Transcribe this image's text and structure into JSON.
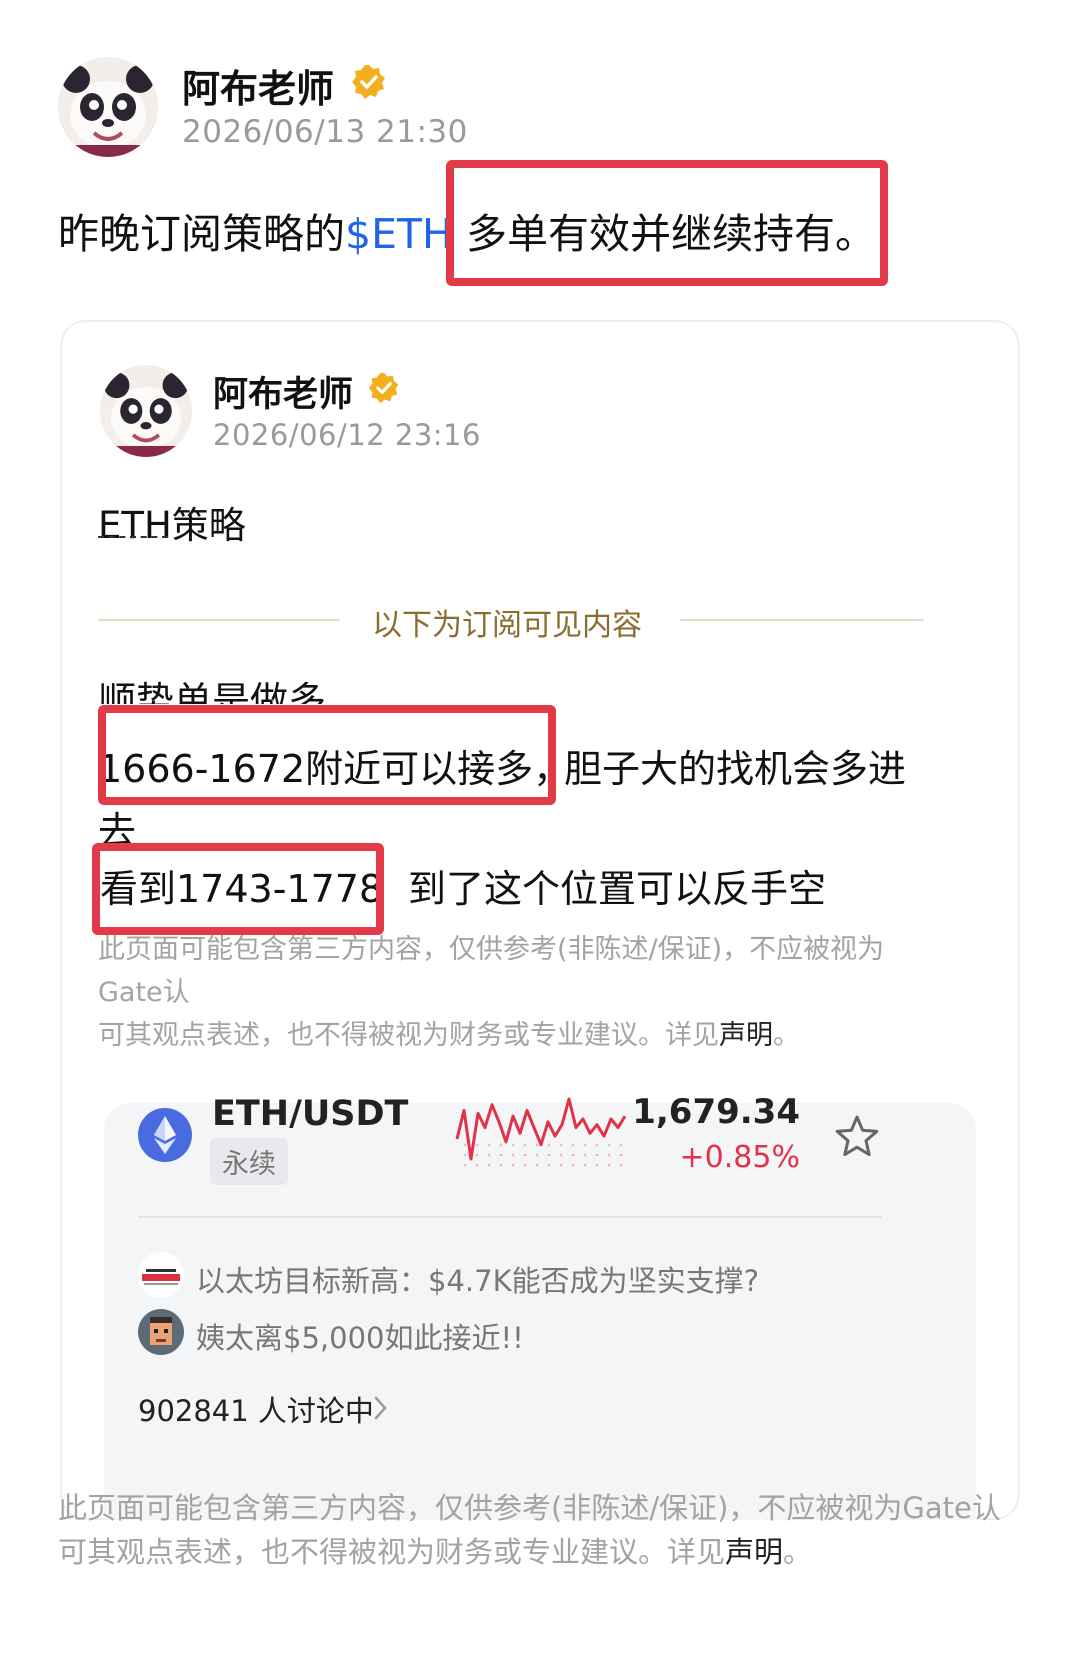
{
  "post": {
    "author": "阿布老师",
    "datetime": "2026/06/13 21:30",
    "text_before": "昨晚订阅策略的",
    "ticker": "$ETH",
    "text_highlight": "多单有效并继续持有。"
  },
  "quoted": {
    "author": "阿布老师",
    "datetime": "2026/06/12 23:16",
    "title": "ETH策略",
    "divider_label": "以下为订阅可见内容",
    "line1": "顺势单是做多",
    "line2_highlight": "1666-1672附近可以接多，",
    "line2_rest": "胆子大的找机会多进",
    "line3": "去",
    "line4_highlight": "看到1743-1778",
    "line4_rest": "到了这个位置可以反手空",
    "disclaimer_1": "此页面可能包含第三方内容，仅供参考(非陈述/保证)，不应被视为Gate认",
    "disclaimer_2": "可其观点表述，也不得被视为财务或专业建议。详见",
    "disclaimer_link": "声明",
    "disclaimer_end": "。"
  },
  "market": {
    "pair": "ETH/USDT",
    "type_tag": "永续",
    "price": "1,679.34",
    "change": "+0.85%",
    "news": [
      {
        "text": "以太坊目标新高：$4.7K能否成为坚实支撑?",
        "icon": "crypto-news-logo-icon"
      },
      {
        "text": "姨太离$5,000如此接近!!",
        "icon": "user-avatar-icon"
      }
    ],
    "discussion_count": "902841 人讨论中"
  },
  "footer": {
    "disclaimer_1": "此页面可能包含第三方内容，仅供参考(非陈述/保证)，不应被视为Gate认",
    "disclaimer_2": "可其观点表述，也不得被视为财务或专业建议。详见",
    "disclaimer_link": "声明",
    "disclaimer_end": "。"
  },
  "colors": {
    "highlight_box": "#e23a46",
    "ticker_link": "#1f63e6",
    "change_positive": "#e0334a",
    "verified_badge": "#f2b01e",
    "eth_logo": "#4a6ae0"
  },
  "chart_data": {
    "type": "line",
    "series": [
      {
        "values": [
          38,
          18,
          52,
          20,
          30,
          14,
          26,
          40,
          22,
          34,
          18,
          30,
          42,
          26,
          36,
          28,
          10,
          30,
          24,
          34,
          28,
          36,
          24,
          30,
          22
        ]
      }
    ]
  }
}
